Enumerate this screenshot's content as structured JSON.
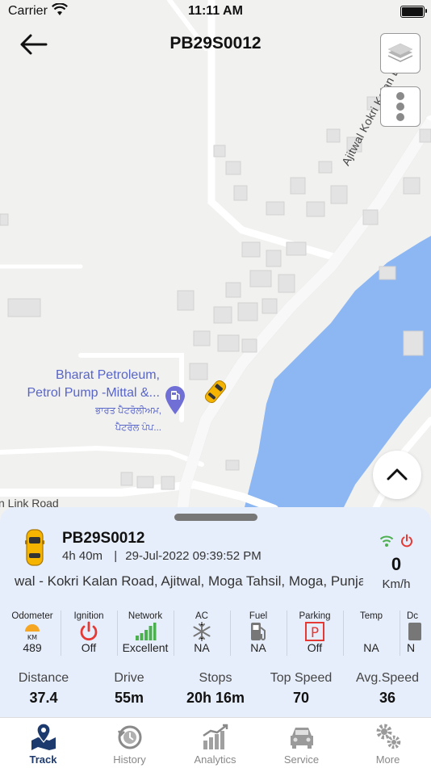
{
  "status_bar": {
    "carrier": "Carrier",
    "time": "11:11 AM"
  },
  "header": {
    "title": "PB29S0012"
  },
  "map": {
    "poi": {
      "name_line1": "Bharat Petroleum,",
      "name_line2": "Petrol Pump -Mittal &...",
      "local_line1": "ਭਾਰਤ ਪੈਟਰੋਲੀਅਮ,",
      "local_line2": "ਪੈਟਰੋਲ ਪੰਪ..."
    },
    "road_label_1": "Ajitwal Kokri Kalan Link R",
    "road_label_2": "n Link Road",
    "water_color": "#8db7f2"
  },
  "vehicle": {
    "name": "PB29S0012",
    "duration": "4h 40m",
    "timestamp": "29-Jul-2022 09:39:52 PM",
    "address": "wal - Kokri Kalan Road, Ajitwal, Moga Tahsil, Moga, Punjab",
    "speed": "0",
    "speed_unit": "Km/h",
    "network_status_color": "#4caf50",
    "power_status_color": "#e53935"
  },
  "params": [
    {
      "label": "Odometer",
      "value": "489",
      "icon": "odometer-icon",
      "sub": "KM"
    },
    {
      "label": "Ignition",
      "value": "Off",
      "icon": "power-icon"
    },
    {
      "label": "Network",
      "value": "Excellent",
      "icon": "signal-bars-icon"
    },
    {
      "label": "AC",
      "value": "NA",
      "icon": "snowflake-icon"
    },
    {
      "label": "Fuel",
      "value": "NA",
      "icon": "fuel-pump-icon"
    },
    {
      "label": "Parking",
      "value": "Off",
      "icon": "parking-icon",
      "glyph": "P"
    },
    {
      "label": "Temp",
      "value": "NA",
      "icon": "temperature-icon"
    },
    {
      "label": "Dc",
      "value": "N",
      "icon": "door-icon"
    }
  ],
  "stats": [
    {
      "label": "Distance",
      "value": "37.4"
    },
    {
      "label": "Drive",
      "value": "55m"
    },
    {
      "label": "Stops",
      "value": "20h 16m"
    },
    {
      "label": "Top Speed",
      "value": "70"
    },
    {
      "label": "Avg.Speed",
      "value": "36"
    }
  ],
  "tabs": [
    {
      "label": "Track",
      "icon": "map-pin-icon",
      "active": true
    },
    {
      "label": "History",
      "icon": "history-icon",
      "active": false
    },
    {
      "label": "Analytics",
      "icon": "analytics-icon",
      "active": false
    },
    {
      "label": "Service",
      "icon": "car-service-icon",
      "active": false
    },
    {
      "label": "More",
      "icon": "gears-icon",
      "active": false
    }
  ],
  "colors": {
    "accent": "#1d3a6e",
    "ignition_off": "#e53935",
    "signal": "#4caf50",
    "sheet_bg": "#e7eefb"
  }
}
